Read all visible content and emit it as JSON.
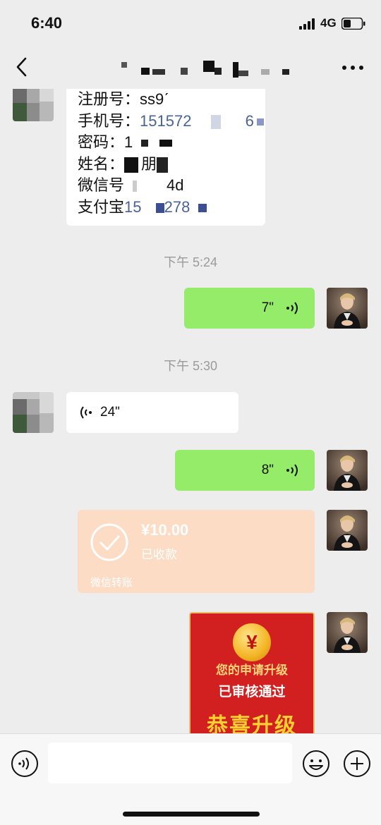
{
  "status_bar": {
    "time": "6:40",
    "network": "4G"
  },
  "nav": {
    "title": ""
  },
  "messages": {
    "info_card": {
      "rows": [
        {
          "label": "注册号：",
          "value": "ss9ˊ"
        },
        {
          "label": "手机号：",
          "value": "151572"
        },
        {
          "label": "密码：",
          "value": "1"
        },
        {
          "label": "姓名：",
          "value": "朋"
        },
        {
          "label": "微信号",
          "value": "4d"
        },
        {
          "label": "支付宝",
          "value": "15"
        }
      ],
      "phone_suffix": "6",
      "alipay_suffix": "278"
    },
    "timestamp_1": "下午 5:24",
    "voice_1": {
      "duration": "7\""
    },
    "timestamp_2": "下午 5:30",
    "voice_2": {
      "duration": "24\""
    },
    "voice_3": {
      "duration": "8\""
    },
    "transfer": {
      "amount": "¥10.00",
      "status": "已收款",
      "label": "微信转账"
    },
    "upgrade_card": {
      "coin_symbol": "¥",
      "line1": "您的申请升级",
      "line2": "已审核通过",
      "line3": "恭喜升级"
    }
  },
  "input_bar": {
    "value": "",
    "placeholder": ""
  },
  "colors": {
    "background": "#ededed",
    "self_bubble": "#95ec69",
    "other_bubble": "#ffffff",
    "transfer_card": "#fcdcc4",
    "upgrade_card": "#d21f1f"
  },
  "icons": [
    "back-icon",
    "more-icon",
    "voice-wave-icon",
    "check-icon",
    "voice-toggle-icon",
    "emoji-icon",
    "plus-icon"
  ]
}
